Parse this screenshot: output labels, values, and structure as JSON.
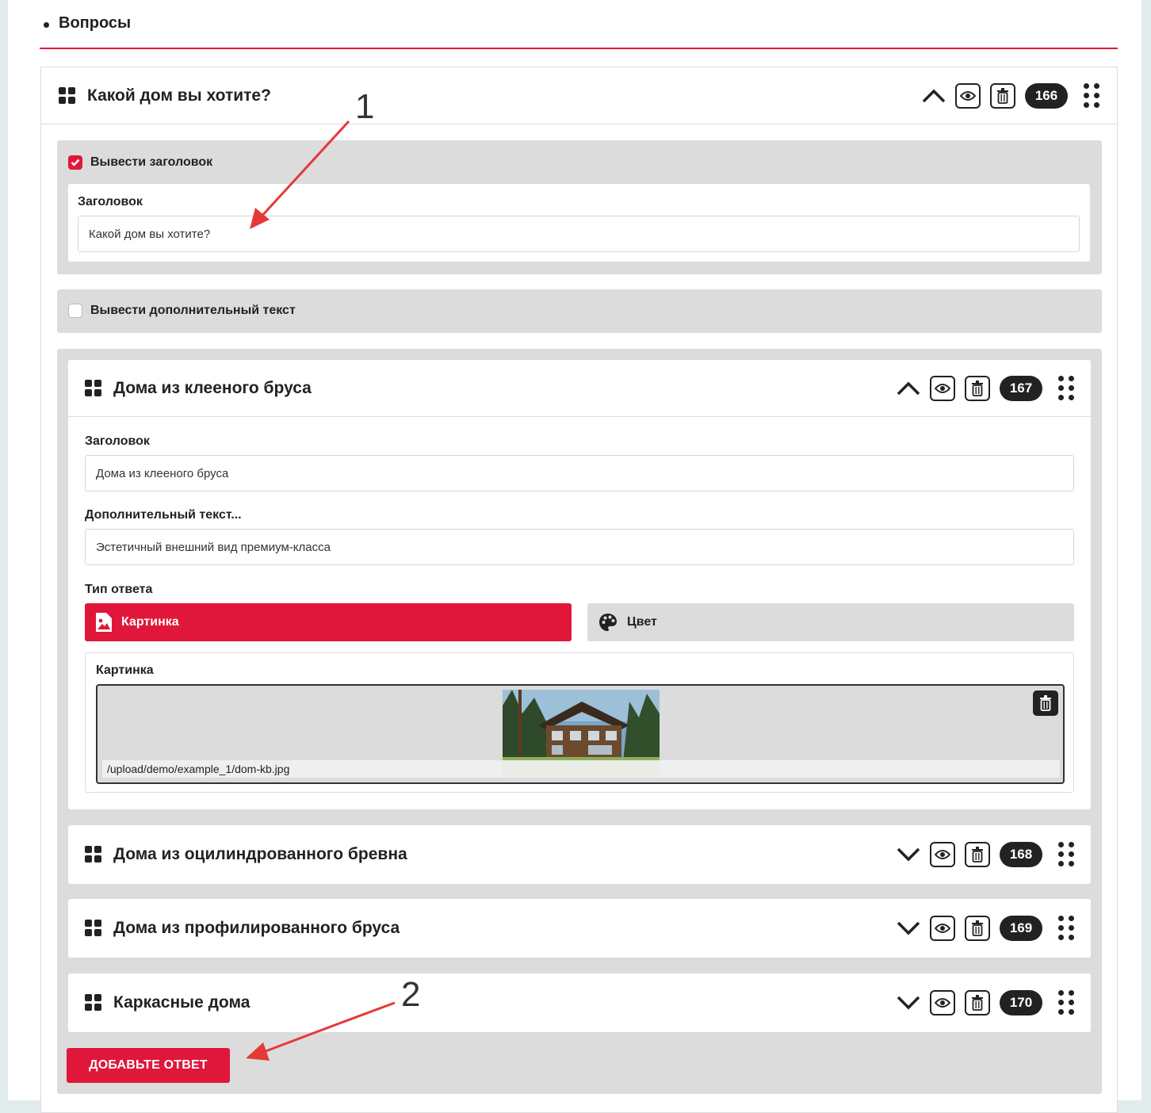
{
  "section": {
    "title": "Вопросы"
  },
  "question": {
    "title": "Какой дом вы хотите?",
    "id_badge": "166",
    "show_title_label": "Вывести заголовок",
    "title_field_label": "Заголовок",
    "title_field_value": "Какой дом вы хотите?",
    "show_extra_text_label": "Вывести дополнительный текст"
  },
  "answers": [
    {
      "title": "Дома из клееного бруса",
      "id_badge": "167",
      "expanded": true,
      "title_field_label": "Заголовок",
      "title_field_value": "Дома из клееного бруса",
      "extra_field_label": "Дополнительный текст...",
      "extra_field_value": "Эстетичный внешний вид премиум-класса",
      "answer_type_label": "Тип ответа",
      "type_options": [
        "Картинка",
        "Цвет"
      ],
      "selected_type": "Картинка",
      "image_label": "Картинка",
      "image_path": "/upload/demo/example_1/dom-kb.jpg"
    },
    {
      "title": "Дома из оцилиндрованного бревна",
      "id_badge": "168",
      "expanded": false
    },
    {
      "title": "Дома из профилированного бруса",
      "id_badge": "169",
      "expanded": false
    },
    {
      "title": "Каркасные дома",
      "id_badge": "170",
      "expanded": false
    }
  ],
  "add_answer_label": "ДОБАВЬТЕ ОТВЕТ",
  "annotations": [
    "1",
    "2"
  ],
  "colors": {
    "accent": "#e0173a",
    "panel_gray": "#dcdcdc",
    "dark": "#222222"
  },
  "icons": [
    "drag-handle-icon",
    "chevron-up-icon",
    "chevron-down-icon",
    "eye-icon",
    "trash-icon",
    "drag-dots-icon",
    "image-icon",
    "palette-icon",
    "check-icon"
  ]
}
